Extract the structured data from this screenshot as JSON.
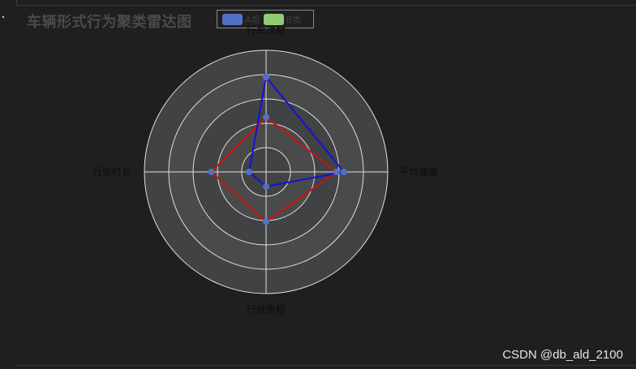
{
  "chart_data": {
    "type": "radar",
    "title": "车辆形式行为聚类雷达图",
    "indicators": [
      "行车次数",
      "平均速度",
      "行驶里程",
      "行驶时长"
    ],
    "max": 1.0,
    "split_number": 5,
    "series": [
      {
        "name": "A类",
        "values": [
          0.78,
          0.64,
          0.12,
          0.14
        ],
        "line_color": "#1111dd",
        "marker_color": "#5470c6"
      },
      {
        "name": "B类",
        "values": [
          0.45,
          0.58,
          0.41,
          0.45
        ],
        "line_color": "#cc1111",
        "marker_color": "#5470c6"
      }
    ],
    "legend": {
      "position": "top",
      "items": [
        {
          "name": "A类",
          "color": "#5470c6"
        },
        {
          "name": "B类",
          "color": "#91cc75"
        }
      ]
    },
    "split_area_colors": [
      "#4a4a4a",
      "#404244"
    ],
    "grid_line_color": "#e0e0e0"
  },
  "watermark": "CSDN @db_ald_2100"
}
